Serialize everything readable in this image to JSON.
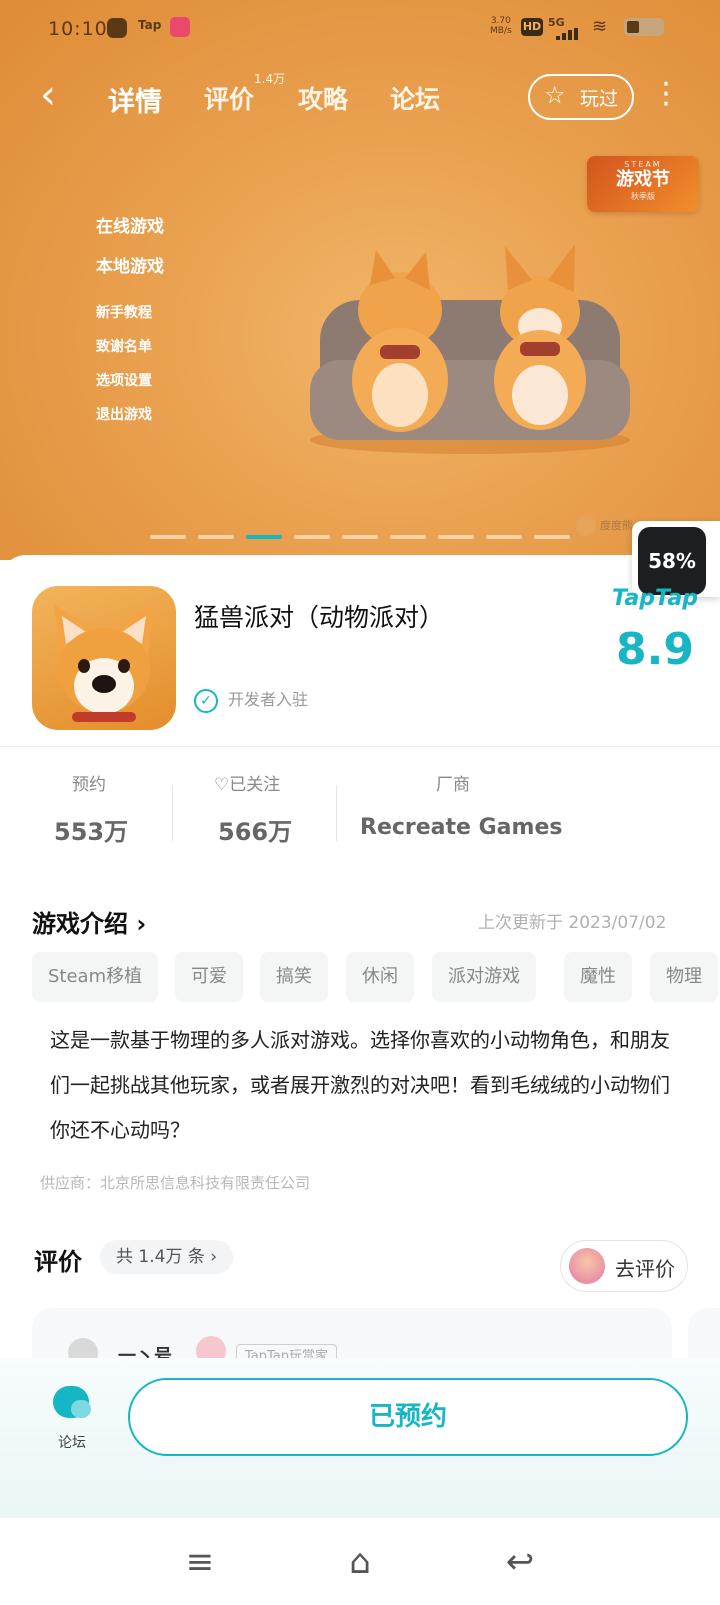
{
  "status_bar": {
    "time": "10:10",
    "app_label": "Tap",
    "speed_top": "3.70",
    "speed_unit": "MB/s",
    "hd": "HD",
    "network": "5G"
  },
  "nav": {
    "tabs": [
      "详情",
      "评价",
      "攻略",
      "论坛"
    ],
    "review_count_sup": "1.4万",
    "played_label": "玩过"
  },
  "banner": {
    "menu": [
      "在线游戏",
      "本地游戏",
      "新手教程",
      "致谢名单",
      "选项设置",
      "退出游戏"
    ],
    "badge_top": "STEAM",
    "badge_main": "游戏节",
    "badge_sub": "秋季版",
    "credit": "度度熊",
    "active_slide_index": 2,
    "slide_count": 9
  },
  "floating_progress": "58%",
  "game": {
    "title": "猛兽派对（动物派对）",
    "verified": "开发者入驻",
    "rating_brand": "TapTap",
    "rating": "8.9"
  },
  "stats": {
    "reserve_label": "预约",
    "reserve_value": "553万",
    "follow_label": "已关注",
    "follow_value": "566万",
    "vendor_label": "厂商",
    "vendor_value": "Recreate Games"
  },
  "intro": {
    "title": "游戏介绍",
    "updated": "上次更新于 2023/07/02",
    "tags": [
      "Steam移植",
      "可爱",
      "搞笑",
      "休闲",
      "派对游戏",
      "魔性",
      "物理"
    ],
    "description": "这是一款基于物理的多人派对游戏。选择你喜欢的小动物角色，和朋友们一起挑战其他玩家，或者展开激烈的对决吧！看到毛绒绒的小动物们你还不心动吗？",
    "supplier": "供应商：北京所思信息科技有限责任公司"
  },
  "reviews": {
    "title": "评价",
    "count": "共 1.4万 条",
    "go_review": "去评价",
    "reviewer_name": "一丶号",
    "reviewer_tag": "TapTap玩赏家"
  },
  "bottom": {
    "forum": "论坛",
    "reserved_button": "已预约"
  }
}
